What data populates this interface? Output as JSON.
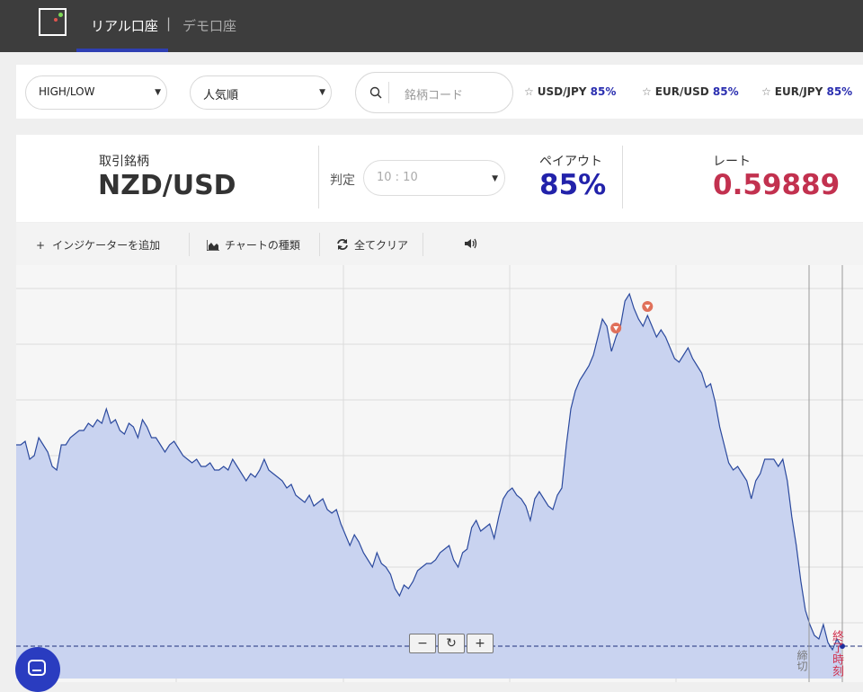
{
  "header": {
    "tabs": [
      {
        "label": "リアル口座",
        "active": true
      },
      {
        "label": "デモ口座",
        "active": false
      }
    ],
    "separator": "|"
  },
  "filters": {
    "trade_type": "HIGH/LOW",
    "sort": "人気順",
    "search_placeholder": "銘柄コード",
    "favorites": [
      {
        "symbol": "USD/JPY",
        "payout": "85%"
      },
      {
        "symbol": "EUR/USD",
        "payout": "85%"
      },
      {
        "symbol": "EUR/JPY",
        "payout": "85%"
      }
    ]
  },
  "info": {
    "symbol_label": "取引銘柄",
    "symbol": "NZD/USD",
    "judge_label": "判定",
    "judge_time": "10 : 10",
    "payout_label": "ペイアウト",
    "payout": "85%",
    "rate_label": "レート",
    "rate": "0.59889"
  },
  "toolbar": {
    "add_indicator": "インジケーターを追加",
    "chart_type": "チャートの種類",
    "clear_all": "全てクリア"
  },
  "chart": {
    "deadline_label": "締切",
    "expiry_label": "終了時刻",
    "zoom_out": "−",
    "zoom_reset": "↻",
    "zoom_in": "+"
  },
  "chart_data": {
    "type": "area",
    "description_of_units": "relative price (no axis labels visible)",
    "values": [
      0.2,
      0.2,
      0.21,
      0.16,
      0.17,
      0.22,
      0.2,
      0.18,
      0.14,
      0.13,
      0.2,
      0.2,
      0.22,
      0.23,
      0.24,
      0.24,
      0.26,
      0.25,
      0.27,
      0.26,
      0.3,
      0.26,
      0.27,
      0.24,
      0.23,
      0.26,
      0.25,
      0.22,
      0.27,
      0.25,
      0.22,
      0.22,
      0.2,
      0.18,
      0.2,
      0.21,
      0.19,
      0.17,
      0.16,
      0.15,
      0.16,
      0.14,
      0.14,
      0.15,
      0.13,
      0.13,
      0.14,
      0.13,
      0.16,
      0.14,
      0.12,
      0.1,
      0.12,
      0.11,
      0.13,
      0.16,
      0.13,
      0.12,
      0.11,
      0.1,
      0.08,
      0.09,
      0.06,
      0.05,
      0.04,
      0.06,
      0.03,
      0.04,
      0.05,
      0.02,
      0.01,
      0.02,
      -0.02,
      -0.05,
      -0.08,
      -0.05,
      -0.07,
      -0.1,
      -0.12,
      -0.14,
      -0.1,
      -0.13,
      -0.14,
      -0.16,
      -0.2,
      -0.22,
      -0.19,
      -0.2,
      -0.18,
      -0.15,
      -0.14,
      -0.13,
      -0.13,
      -0.12,
      -0.1,
      -0.09,
      -0.08,
      -0.12,
      -0.14,
      -0.1,
      -0.09,
      -0.03,
      -0.01,
      -0.04,
      -0.03,
      -0.02,
      -0.06,
      0.0,
      0.05,
      0.07,
      0.08,
      0.06,
      0.05,
      0.03,
      -0.01,
      0.05,
      0.07,
      0.05,
      0.03,
      0.02,
      0.06,
      0.08,
      0.2,
      0.3,
      0.35,
      0.38,
      0.4,
      0.42,
      0.45,
      0.5,
      0.55,
      0.53,
      0.46,
      0.5,
      0.53,
      0.6,
      0.62,
      0.58,
      0.55,
      0.53,
      0.56,
      0.53,
      0.5,
      0.52,
      0.5,
      0.47,
      0.44,
      0.43,
      0.45,
      0.47,
      0.44,
      0.42,
      0.4,
      0.36,
      0.37,
      0.32,
      0.25,
      0.2,
      0.15,
      0.13,
      0.14,
      0.12,
      0.1,
      0.05,
      0.1,
      0.12,
      0.16,
      0.16,
      0.16,
      0.14,
      0.16,
      0.1,
      0.0,
      -0.08,
      -0.18,
      -0.26,
      -0.3,
      -0.33,
      -0.34,
      -0.3,
      -0.35,
      -0.37,
      -0.34,
      -0.36
    ],
    "markers": [
      {
        "index": 133,
        "type": "high-entry"
      },
      {
        "index": 140,
        "type": "high-entry"
      }
    ],
    "grid": true,
    "reference_line": true
  }
}
